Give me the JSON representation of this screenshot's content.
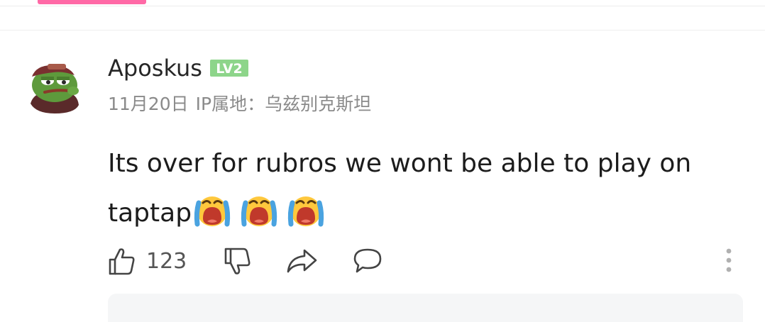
{
  "comment": {
    "username": "Aposkus",
    "level_badge": "LV2",
    "date": "11月20日",
    "ip_location": "IP属地：乌兹别克斯坦",
    "text": "Its over for rubros we wont be able to play on taptap",
    "emojis": [
      "crying-face",
      "crying-face",
      "crying-face"
    ],
    "like_count": "123"
  },
  "icons": {
    "like": "thumbs-up-icon",
    "dislike": "thumbs-down-icon",
    "share": "share-arrow-icon",
    "reply": "speech-bubble-icon",
    "more": "more-vertical-icon"
  },
  "colors": {
    "tab_indicator": "#ff69a6",
    "level_badge": "#8dd58a",
    "meta_text": "#8a8a8a",
    "reply_author": "#2f6fb3"
  }
}
